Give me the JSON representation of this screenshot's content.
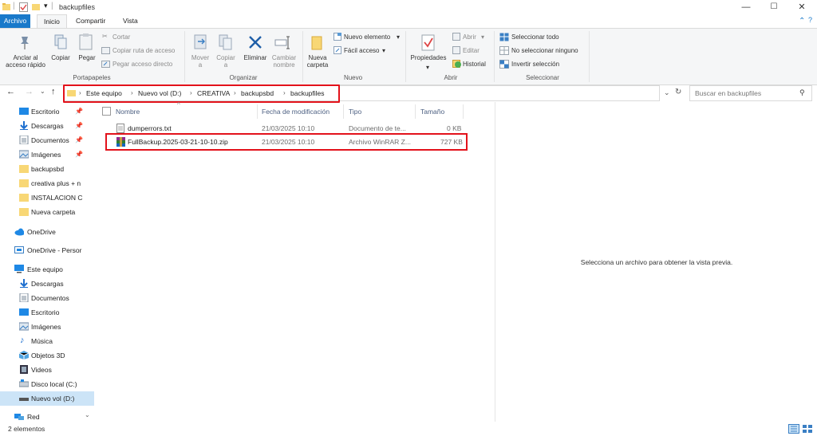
{
  "window": {
    "title": "backupfiles",
    "controls": {
      "minimize": "—",
      "maximize": "☐",
      "close": "✕"
    }
  },
  "tabs": [
    {
      "label": "Archivo"
    },
    {
      "label": "Inicio"
    },
    {
      "label": "Compartir"
    },
    {
      "label": "Vista"
    }
  ],
  "ribbon": {
    "portapapeles": {
      "pin": "Anclar al\nacceso rápido",
      "copy": "Copiar",
      "paste": "Pegar",
      "cut": "Cortar",
      "copy_path": "Copiar ruta de acceso",
      "paste_shortcut": "Pegar acceso directo",
      "label": "Portapapeles"
    },
    "organizar": {
      "move": "Mover\na",
      "copy_to": "Copiar\na",
      "delete": "Eliminar",
      "rename": "Cambiar\nnombre",
      "label": "Organizar"
    },
    "nuevo": {
      "new_folder": "Nueva\ncarpeta",
      "new_item": "Nuevo elemento",
      "easy_access": "Fácil acceso",
      "label": "Nuevo"
    },
    "abrir": {
      "properties": "Propiedades",
      "open": "Abrir",
      "edit": "Editar",
      "history": "Historial",
      "label": "Abrir"
    },
    "seleccionar": {
      "select_all": "Seleccionar todo",
      "select_none": "No seleccionar ninguno",
      "invert": "Invertir selección",
      "label": "Seleccionar"
    }
  },
  "address": {
    "crumbs": [
      "Este equipo",
      "Nuevo vol (D:)",
      "CREATIVA",
      "backupsbd",
      "backupfiles"
    ],
    "search_placeholder": "Buscar en backupfiles"
  },
  "nav": {
    "quick": [
      {
        "label": "Escritorio",
        "pinned": true
      },
      {
        "label": "Descargas",
        "pinned": true
      },
      {
        "label": "Documentos",
        "pinned": true
      },
      {
        "label": "Imágenes",
        "pinned": true
      },
      {
        "label": "backupsbd",
        "pinned": false
      },
      {
        "label": "creativa plus + n",
        "pinned": false
      },
      {
        "label": "INSTALACION C",
        "pinned": false
      },
      {
        "label": "Nueva carpeta",
        "pinned": false
      }
    ],
    "onedrive": "OneDrive",
    "onedrive_personal": "OneDrive - Persor",
    "this_pc": "Este equipo",
    "pc_items": [
      "Descargas",
      "Documentos",
      "Escritorio",
      "Imágenes",
      "Música",
      "Objetos 3D",
      "Videos",
      "Disco local (C:)",
      "Nuevo vol (D:)"
    ],
    "network": "Red"
  },
  "columns": {
    "name": "Nombre",
    "date": "Fecha de modificación",
    "type": "Tipo",
    "size": "Tamaño"
  },
  "files": [
    {
      "name": "dumperrors.txt",
      "date": "21/03/2025 10:10",
      "type": "Documento de te...",
      "size": "0 KB"
    },
    {
      "name": "FullBackup.2025-03-21-10-10.zip",
      "date": "21/03/2025 10:10",
      "type": "Archivo WinRAR Z...",
      "size": "727 KB"
    }
  ],
  "preview_text": "Selecciona un archivo para obtener la vista previa.",
  "status": {
    "count": "2 elementos"
  },
  "colors": {
    "accent": "#1979ca",
    "highlight": "#e3121b",
    "selected": "#cce4f7",
    "folder": "#f8d775"
  }
}
